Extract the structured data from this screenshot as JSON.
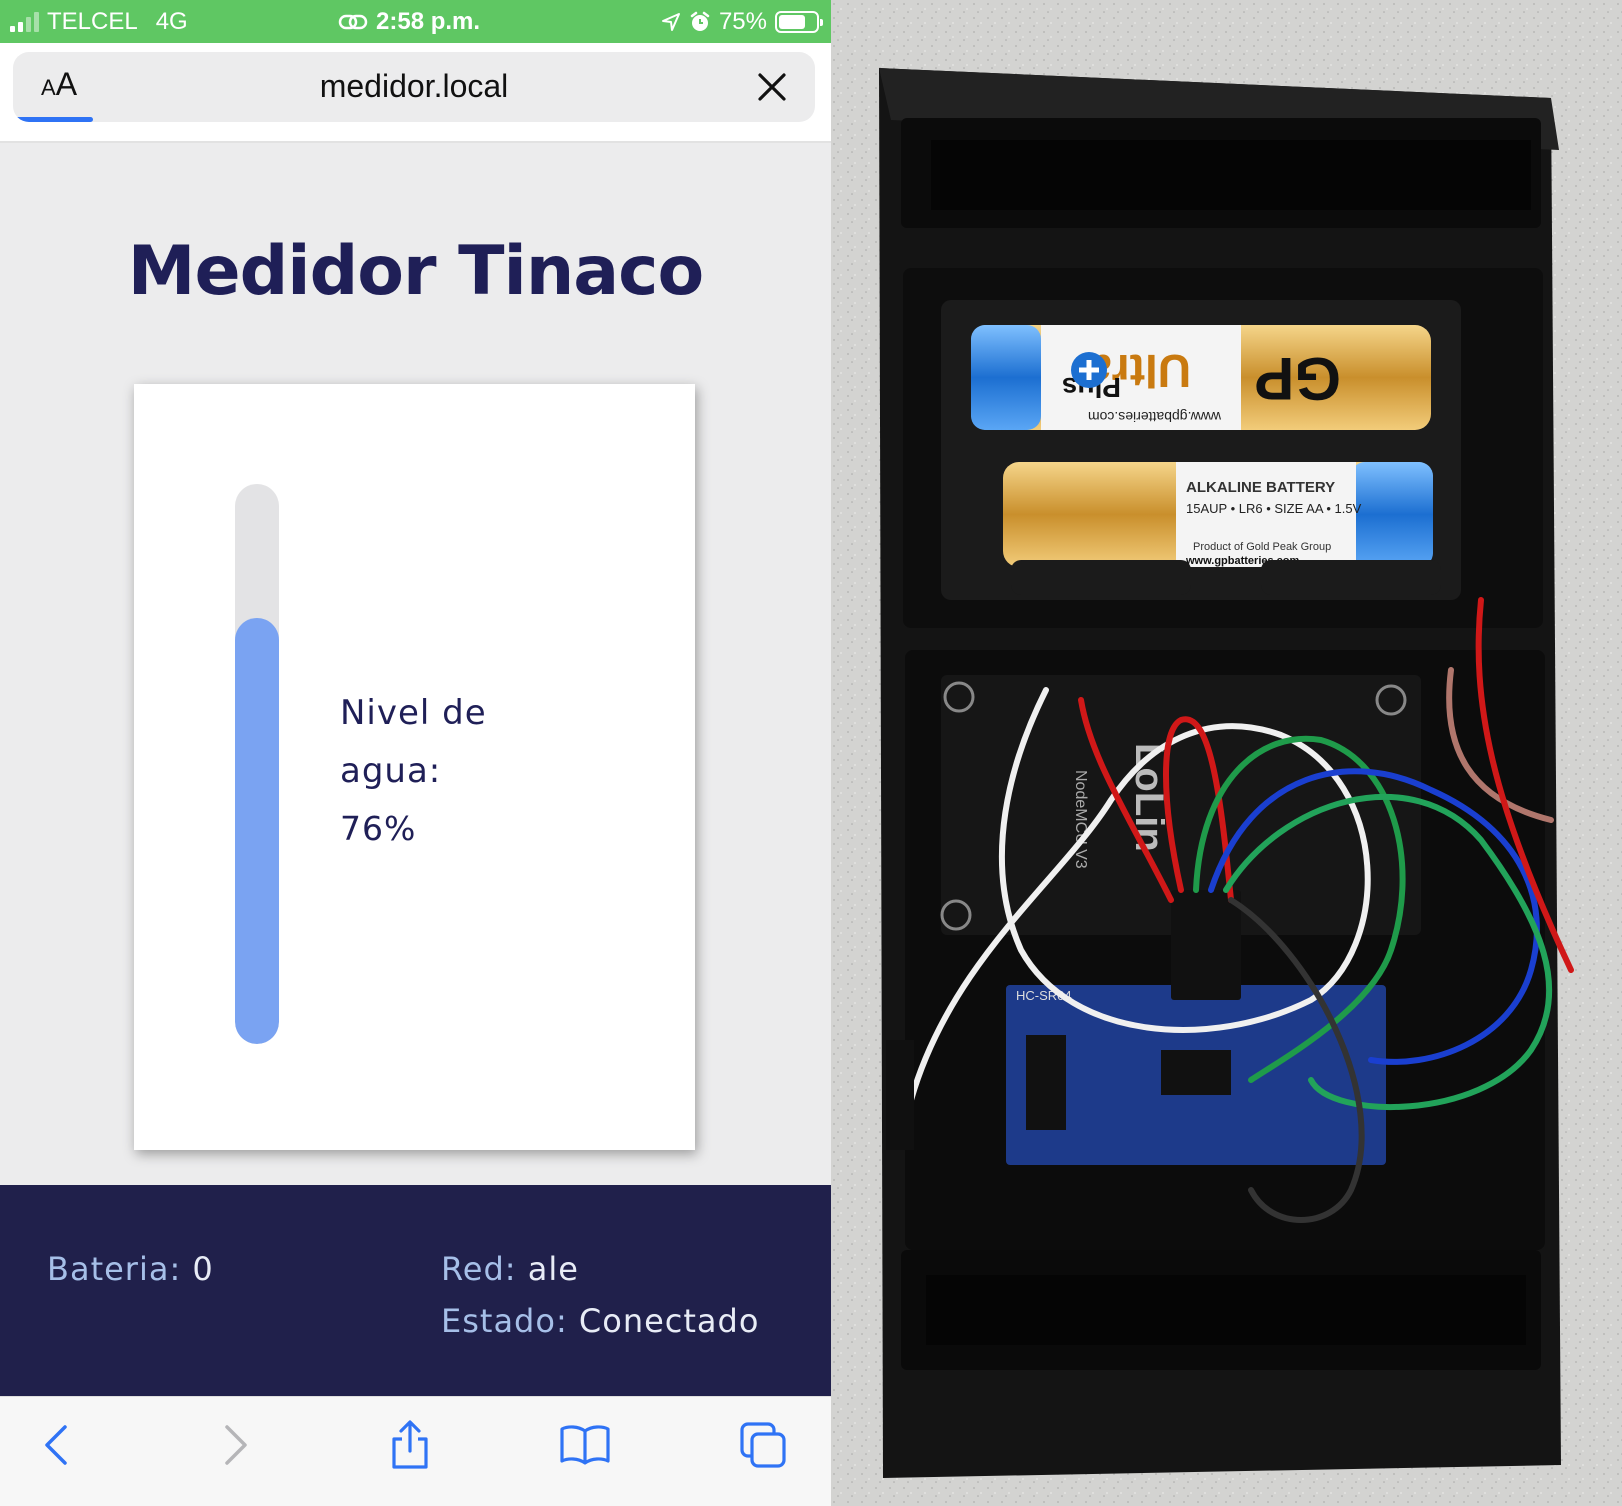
{
  "status_bar": {
    "carrier": "TELCEL",
    "network": "4G",
    "time": "2:58 p.m.",
    "battery_percent": "75%",
    "battery_level": 0.75,
    "icons": [
      "signal-icon",
      "link-icon",
      "location-icon",
      "alarm-icon",
      "battery-icon"
    ]
  },
  "browser": {
    "text_size_small": "A",
    "text_size_large": "A",
    "url": "medidor.local",
    "load_progress": 0.1,
    "close_icon": "close-icon"
  },
  "page": {
    "title": "Medidor Tinaco",
    "level_label_line1": "Nivel de",
    "level_label_line2": "agua:",
    "level_value": "76%",
    "level_fraction": 0.76,
    "accent_color": "#7aa3f2",
    "title_color": "#1f1f57"
  },
  "footer": {
    "battery_label": "Bateria:",
    "battery_value": "0",
    "network_label": "Red:",
    "network_value": "ale",
    "state_label": "Estado:",
    "state_value": "Conectado",
    "background_color": "#20204b"
  },
  "toolbar": {
    "buttons": [
      "back-icon",
      "forward-icon",
      "share-icon",
      "bookmarks-icon",
      "tabs-icon"
    ]
  },
  "photo": {
    "battery_top_brand": "GP",
    "battery_top_line1": "Ultra",
    "battery_top_line2": "Plus",
    "battery_top_web": "www.gpbatteries.com",
    "battery_bottom_line1": "ALKALINE BATTERY",
    "battery_bottom_line2": "15AUP • LR6 • SIZE AA • 1.5V",
    "battery_bottom_line3": "Product of Gold Peak Group",
    "battery_bottom_web": "www.gpbatteries.com",
    "board_label": "NodeMCU V3",
    "board_brand": "LoLin",
    "sensor_label": "HC-SR04"
  }
}
